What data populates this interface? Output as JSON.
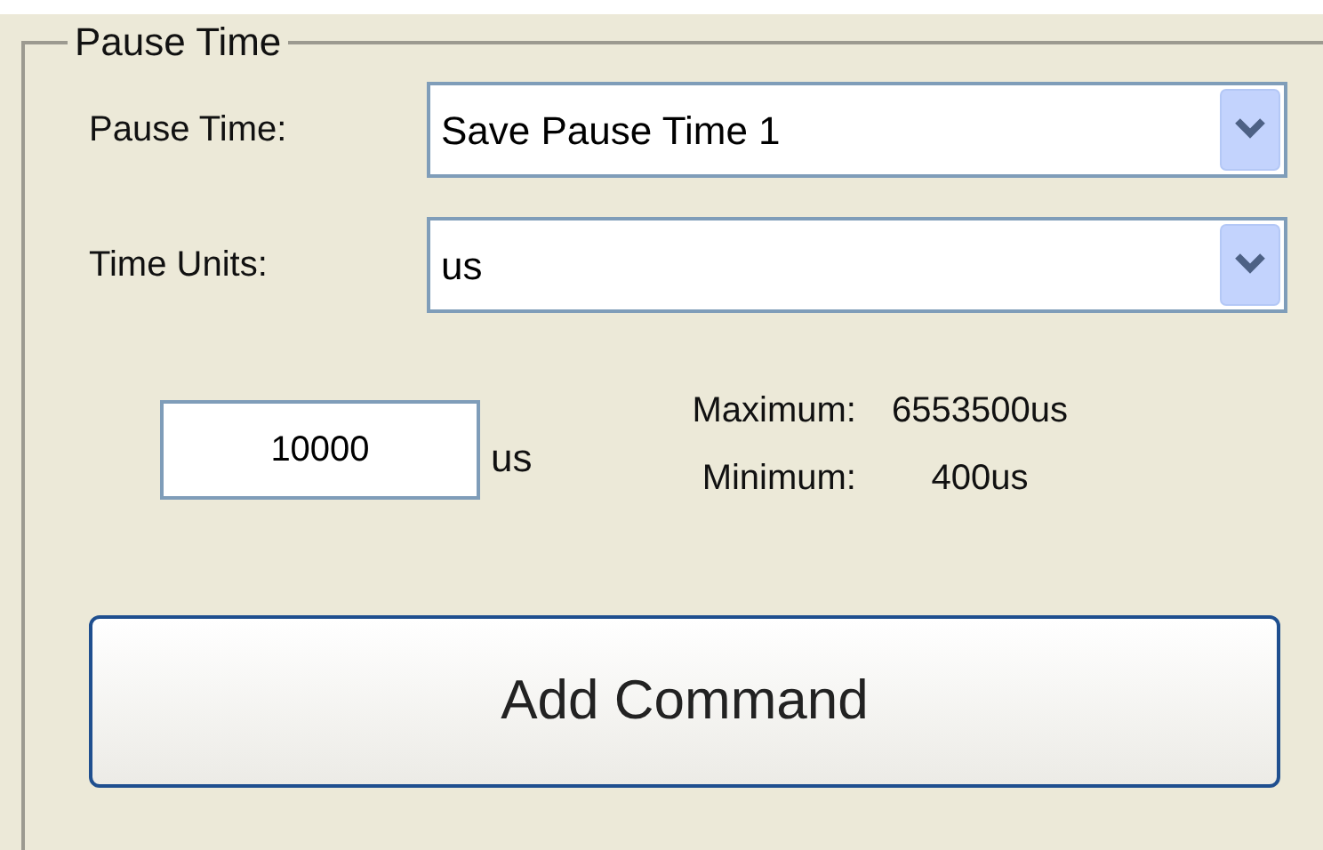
{
  "group": {
    "title": "Pause Time"
  },
  "fields": [
    {
      "label": "Pause Time:",
      "value": "Save Pause Time 1"
    },
    {
      "label": "Time Units:",
      "value": "us"
    }
  ],
  "time_input": {
    "value": "10000",
    "unit": "us"
  },
  "limits": [
    {
      "label": "Maximum:",
      "value": "6553500us"
    },
    {
      "label": "Minimum:",
      "value": "400us"
    }
  ],
  "button": {
    "label": "Add Command"
  }
}
